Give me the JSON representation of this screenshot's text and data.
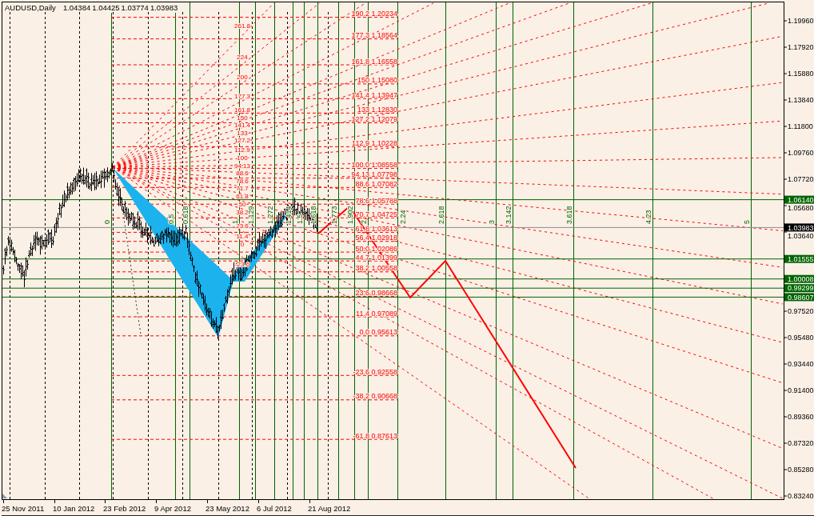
{
  "chart": {
    "symbol": "AUDUSD,Daily",
    "ohlc": [
      "1.04384",
      "1.04425",
      "1.03774",
      "1.03983"
    ],
    "fan_levels": [
      "261.8",
      "224",
      "200",
      "177.3",
      "161.8",
      "150",
      "141.4",
      "133",
      "127.2",
      "112.9",
      "100",
      "94.13",
      "88.6",
      "78.6",
      "71.7",
      "61.8",
      "50",
      "38.2",
      "23.6",
      "11.4",
      "0",
      "-23.6"
    ],
    "retracement_levels": [
      "190.2 1.20234",
      "177.3 1.18564",
      "161.8 1.16558",
      "150 1.15080",
      "141.4 1.13947",
      "133 1.12830",
      "127.2 1.12079",
      "112.9 1.10228",
      "100.0 1.08558",
      "94.13 1.07798",
      "88.6 1.07082",
      "78.6 1.05788",
      "70.7 1.04725",
      "61.8 1.03613",
      "56.4 1.02918",
      "50.0 1.02086",
      "44.7 1.01399",
      "38.2 1.00558",
      "23.6 0.98668",
      "11.4 0.97089",
      "0.0 0.95613",
      "-23.6 0.92558",
      "-38.2 0.90668",
      "-61.8 0.87613"
    ],
    "time_zones": [
      "0",
      "0.5",
      "0.618",
      "1",
      "1.129",
      "1.272",
      "1.414",
      "1.5",
      "1.618",
      "1.773",
      "1.902",
      "2",
      "2.24",
      "2.618",
      "3",
      "3.142",
      "3.618",
      "4.23",
      "5"
    ],
    "price_lines": [
      {
        "kind": "level",
        "tag": "1.06140"
      },
      {
        "kind": "bid",
        "tag": "1.03983"
      },
      {
        "kind": "level",
        "tag": "1.01555"
      },
      {
        "kind": "level",
        "tag": "1.00008"
      },
      {
        "kind": "level",
        "tag": "0.99299"
      },
      {
        "kind": "level",
        "tag": "0.98607"
      }
    ]
  },
  "price_axis": {
    "labels": [
      "1.19960",
      "1.17920",
      "1.15880",
      "1.13840",
      "1.11800",
      "1.09760",
      "1.07720",
      "1.05680",
      "1.03640",
      "0.97520",
      "0.95480",
      "0.93440",
      "0.91400",
      "0.89360",
      "0.87320",
      "0.85280",
      "0.83240"
    ]
  },
  "time_axis": {
    "labels": [
      "25 Nov 2011",
      "10 Jan 2012",
      "23 Feb 2012",
      "9 Apr 2012",
      "23 May 2012",
      "6 Jul 2012",
      "21 Aug 2012"
    ]
  }
}
